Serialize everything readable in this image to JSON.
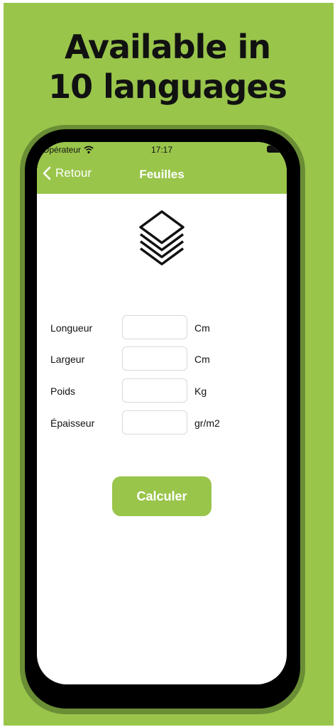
{
  "promo": {
    "headline_line1": "Available in",
    "headline_line2": "10 languages"
  },
  "status_bar": {
    "carrier": "Opérateur",
    "time": "17:17"
  },
  "nav": {
    "back_label": "Retour",
    "title": "Feuilles"
  },
  "icons": {
    "header": "layers-icon",
    "back": "chevron-left-icon",
    "wifi": "wifi-icon",
    "battery": "battery-icon"
  },
  "form": {
    "rows": [
      {
        "label": "Longueur",
        "value": "",
        "unit": "Cm"
      },
      {
        "label": "Largeur",
        "value": "",
        "unit": "Cm"
      },
      {
        "label": "Poids",
        "value": "",
        "unit": "Kg"
      },
      {
        "label": "Épaisseur",
        "value": "",
        "unit": "gr/m2"
      }
    ]
  },
  "action": {
    "calculate_label": "Calculer"
  },
  "colors": {
    "brand_green": "#99c54b",
    "frame_dark_green": "#6a8e35"
  }
}
